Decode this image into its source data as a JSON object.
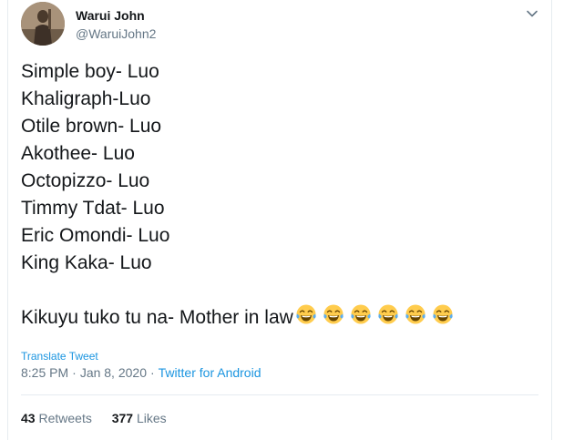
{
  "author": {
    "name": "Warui John",
    "handle": "@WaruiJohn2"
  },
  "tweet": {
    "lines": [
      "Simple boy- Luo",
      "Khaligraph-Luo",
      "Otile brown- Luo",
      "Akothee- Luo",
      "Octopizzo- Luo",
      "Timmy Tdat- Luo",
      "Eric Omondi- Luo",
      "King Kaka- Luo"
    ],
    "last_line": "Kikuyu tuko tu na- Mother in law",
    "emoji_name": "face-with-tears-of-joy-icon",
    "emoji_count": 6
  },
  "translate_label": "Translate Tweet",
  "meta": {
    "time": "8:25 PM",
    "separator1": "·",
    "date": "Jan 8, 2020",
    "separator2": "·",
    "source": "Twitter for Android"
  },
  "stats": {
    "retweets_count": "43",
    "retweets_label": "Retweets",
    "likes_count": "377",
    "likes_label": "Likes"
  },
  "colors": {
    "link": "#1b95e0",
    "secondary": "#657786",
    "primary": "#14171a",
    "border": "#e6ecf0"
  }
}
